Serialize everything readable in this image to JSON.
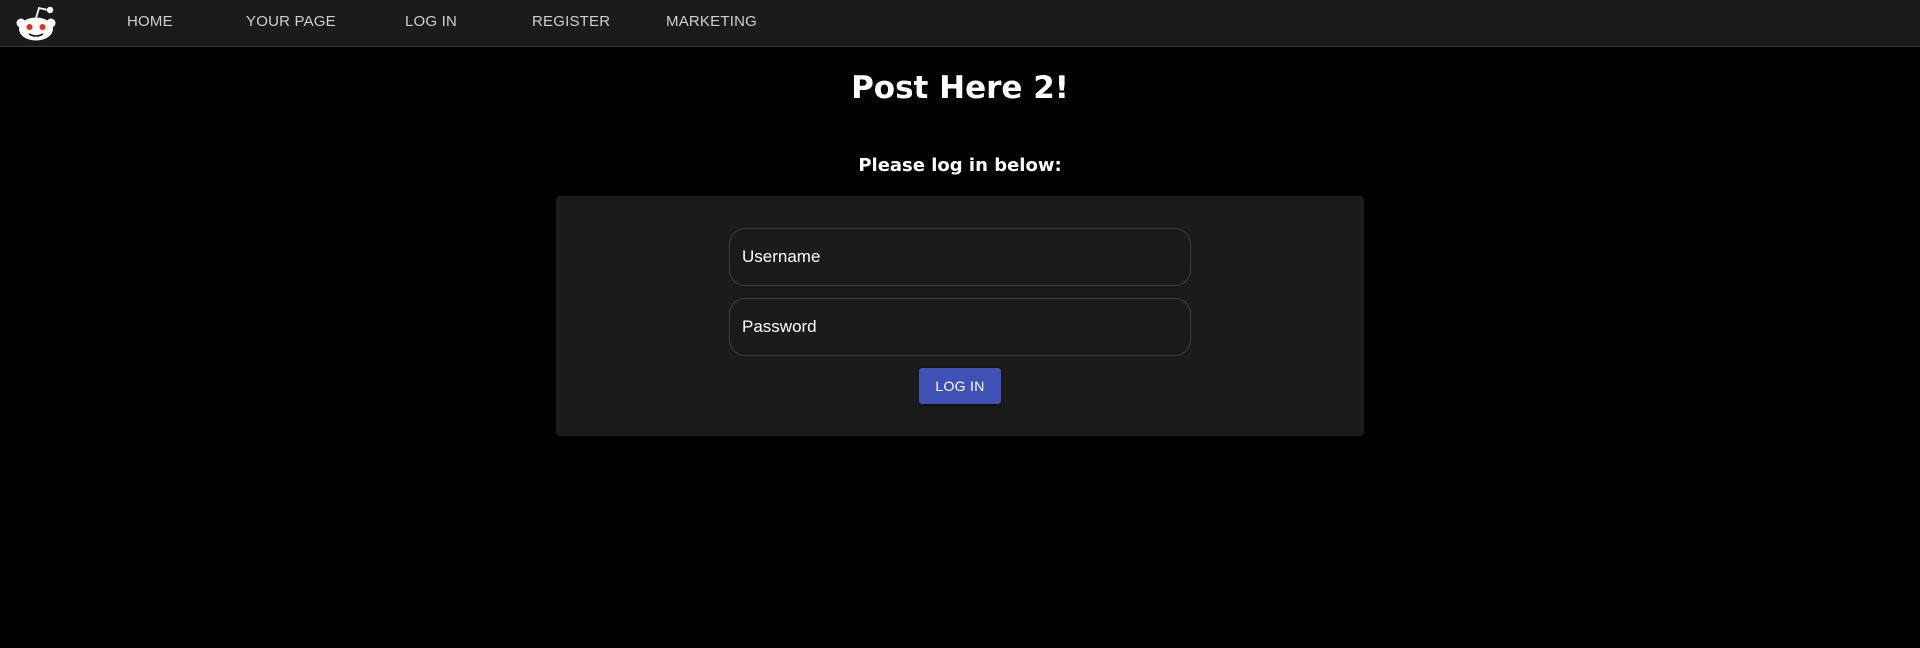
{
  "nav": {
    "logo_icon": "reddit-alien-icon",
    "items": [
      {
        "label": "HOME"
      },
      {
        "label": "YOUR PAGE"
      },
      {
        "label": "LOG IN"
      },
      {
        "label": "REGISTER"
      },
      {
        "label": "MARKETING"
      }
    ]
  },
  "main": {
    "title": "Post Here 2!",
    "subtitle": "Please log in below:",
    "form": {
      "username": {
        "value": "",
        "placeholder": "Username"
      },
      "password": {
        "value": "",
        "placeholder": "Password"
      },
      "submit_label": "LOG IN"
    }
  },
  "colors": {
    "background": "#000000",
    "navbar": "#1b1b1b",
    "card": "#1b1b1b",
    "accent": "#3f51b5",
    "text": "#ffffff",
    "nav_text": "#cfcfcf"
  }
}
